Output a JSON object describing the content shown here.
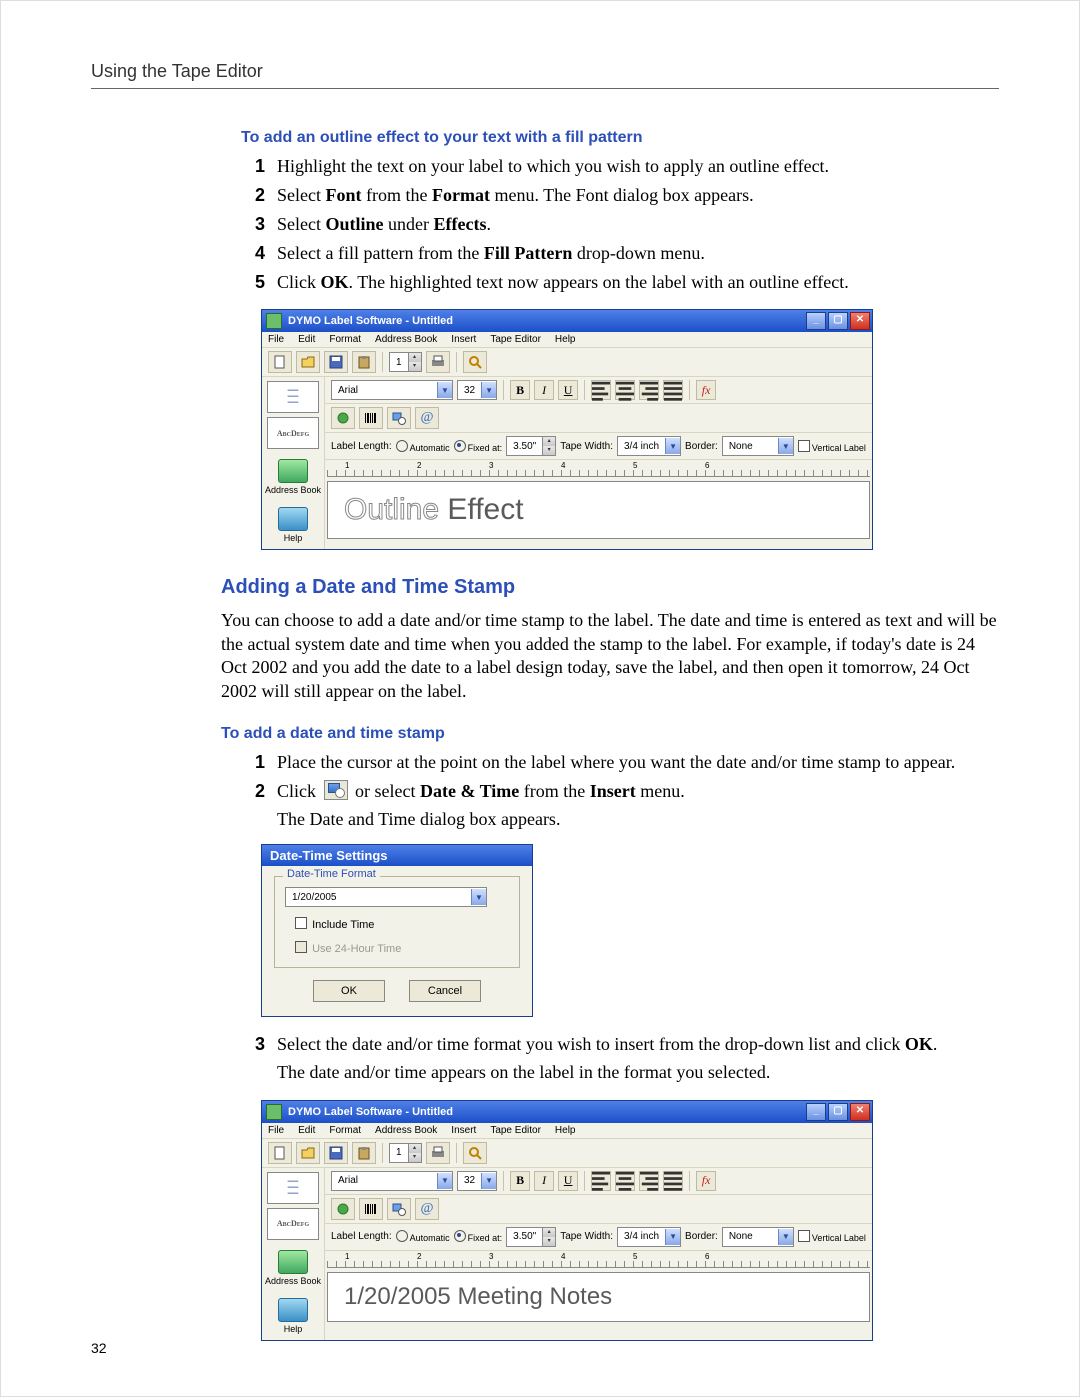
{
  "running_head": "Using the Tape Editor",
  "page_number": "32",
  "sectionA": {
    "heading": "To add an outline effect to your text with a fill pattern",
    "steps": [
      {
        "n": "1",
        "html": "Highlight the text on your label to which you wish to apply an outline effect."
      },
      {
        "n": "2",
        "html": "Select <b>Font</b> from the <b>Format</b> menu. The Font dialog box appears."
      },
      {
        "n": "3",
        "html": "Select <b>Outline</b> under <b>Effects</b>."
      },
      {
        "n": "4",
        "html": "Select a fill pattern from the <b>Fill Pattern</b> drop-down menu."
      },
      {
        "n": "5",
        "html": "Click <b>OK</b>. The highlighted text now appears on the label with an outline effect."
      }
    ]
  },
  "dymo": {
    "title": "DYMO Label Software - Untitled",
    "menus": [
      "File",
      "Edit",
      "Format",
      "Address Book",
      "Insert",
      "Tape Editor",
      "Help"
    ],
    "toolbar1_spin": "1",
    "font": "Arial",
    "font_size": "32",
    "label_length_label": "Label Length:",
    "radio_auto": "Automatic",
    "radio_fixed": "Fixed at:",
    "fixed_value": "3.50\"",
    "tape_width_label": "Tape Width:",
    "tape_width_value": "3/4 inch",
    "border_label": "Border:",
    "border_value": "None",
    "vertical_label": "Vertical Label",
    "ruler_marks": [
      "1",
      "2",
      "3",
      "4",
      "5",
      "6"
    ],
    "sidebar_label1": "Address Book",
    "sidebar_label2": "Help",
    "canvas1_a": "Outline ",
    "canvas1_b": "Effect",
    "canvas2": "1/20/2005 Meeting Notes"
  },
  "sectionB": {
    "title": "Adding a Date and Time Stamp",
    "para": "You can choose to add a date and/or time stamp to the label. The date and time is entered as text and will be the actual system date and time when you added the stamp to the label. For example, if today's date is 24 Oct 2002 and you add the date to a label design today, save the label, and then open it tomorrow, 24 Oct 2002 will still appear on the label.",
    "heading": "To add a date and time stamp",
    "step1": {
      "n": "1",
      "txt": "Place the cursor at the point on the label where you want the date and/or time stamp to appear."
    },
    "step2": {
      "n": "2",
      "pre": "Click ",
      "post": " or select <b>Date & Time</b> from the <b>Insert</b> menu.",
      "sub": "The Date and Time dialog box appears."
    },
    "step3": {
      "n": "3",
      "txt": "Select the date and/or time format you wish to insert from the drop-down list and click <b>OK</b>.",
      "sub": "The date and/or time appears on the label in the format you selected."
    }
  },
  "dt_dialog": {
    "title": "Date-Time Settings",
    "legend": "Date-Time Format",
    "value": "1/20/2005",
    "opt_include": "Include Time",
    "opt_24h": "Use 24-Hour Time",
    "ok": "OK",
    "cancel": "Cancel"
  }
}
